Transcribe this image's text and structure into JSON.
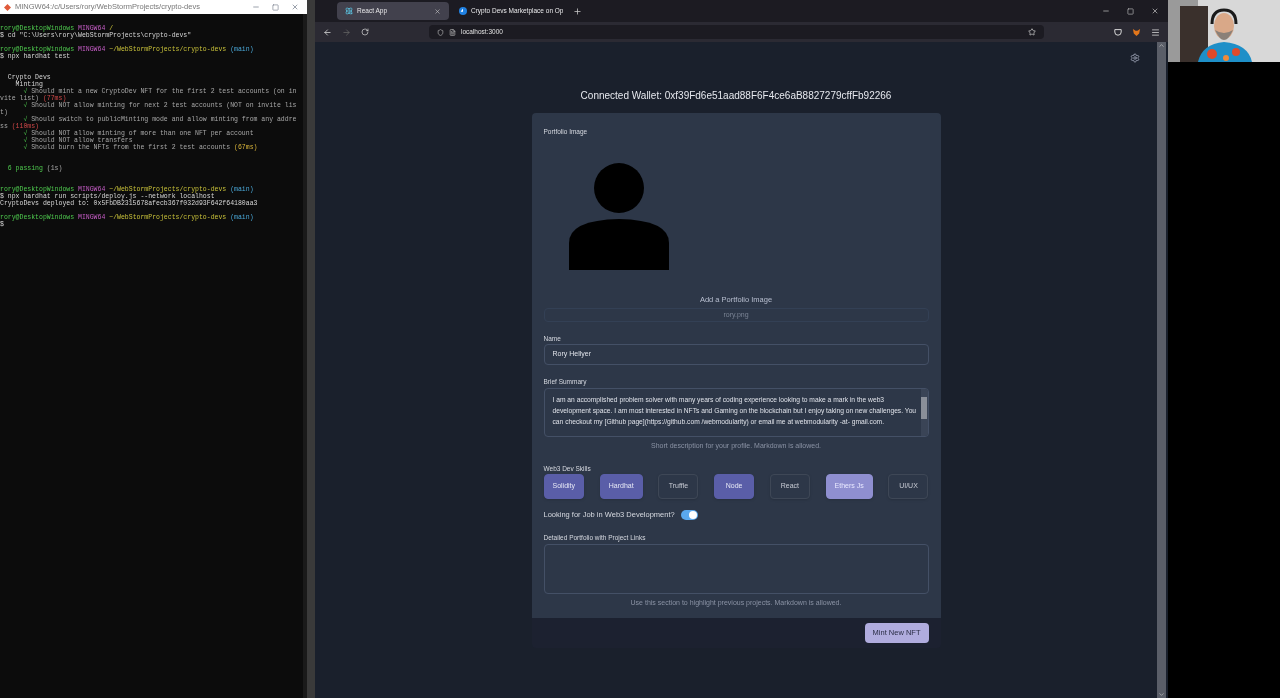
{
  "terminal": {
    "title": "MINGW64:/c/Users/rory/WebStormProjects/crypto-devs",
    "lines": [
      {
        "kind": "text",
        "segments": [
          {
            "text": "rory@DesktopWindows ",
            "kind": "user"
          },
          {
            "text": "MINGW64 ",
            "kind": "shell"
          },
          {
            "text": "/",
            "kind": "path"
          }
        ]
      },
      {
        "kind": "text",
        "segments": [
          {
            "text": "$ cd \"C:\\Users\\rory\\WebStormProjects\\crypto-devs\"",
            "kind": "plain"
          }
        ]
      },
      {
        "kind": "blank"
      },
      {
        "kind": "text",
        "segments": [
          {
            "text": "rory@DesktopWindows ",
            "kind": "user"
          },
          {
            "text": "MINGW64 ",
            "kind": "shell"
          },
          {
            "text": "~/WebStormProjects/crypto-devs ",
            "kind": "path"
          },
          {
            "text": "(main)",
            "kind": "branch"
          }
        ]
      },
      {
        "kind": "text",
        "segments": [
          {
            "text": "$ npx hardhat test",
            "kind": "plain"
          }
        ]
      },
      {
        "kind": "blank"
      },
      {
        "kind": "blank"
      },
      {
        "kind": "text",
        "segments": [
          {
            "text": "  Crypto Devs",
            "kind": "plain"
          }
        ]
      },
      {
        "kind": "text",
        "segments": [
          {
            "text": "    Minting",
            "kind": "plain"
          }
        ]
      },
      {
        "kind": "text",
        "segments": [
          {
            "text": "      √",
            "kind": "pass"
          },
          {
            "text": " Should mint a new CryptoDev NFT for the first 2 test accounts (on in",
            "kind": "dim"
          }
        ]
      },
      {
        "kind": "text",
        "segments": [
          {
            "text": "vite list) ",
            "kind": "dim"
          },
          {
            "text": "(77ms)",
            "kind": "slow"
          }
        ]
      },
      {
        "kind": "text",
        "segments": [
          {
            "text": "      √",
            "kind": "pass"
          },
          {
            "text": " Should NOT allow minting for next 2 test accounts (NOT on invite lis",
            "kind": "dim"
          }
        ]
      },
      {
        "kind": "text",
        "segments": [
          {
            "text": "t)",
            "kind": "dim"
          }
        ]
      },
      {
        "kind": "text",
        "segments": [
          {
            "text": "      √",
            "kind": "pass"
          },
          {
            "text": " Should switch to publicMinting mode and allow minting from any addre",
            "kind": "dim"
          }
        ]
      },
      {
        "kind": "text",
        "segments": [
          {
            "text": "ss ",
            "kind": "dim"
          },
          {
            "text": "(110ms)",
            "kind": "slow"
          }
        ]
      },
      {
        "kind": "text",
        "segments": [
          {
            "text": "      √",
            "kind": "pass"
          },
          {
            "text": " Should NOT allow minting of more than one NFT per account",
            "kind": "dim"
          }
        ]
      },
      {
        "kind": "text",
        "segments": [
          {
            "text": "      √",
            "kind": "pass"
          },
          {
            "text": " Should NOT allow transfers",
            "kind": "dim"
          }
        ]
      },
      {
        "kind": "text",
        "segments": [
          {
            "text": "      √",
            "kind": "pass"
          },
          {
            "text": " Should burn the NFTs from the first 2 test accounts ",
            "kind": "dim"
          },
          {
            "text": "(67ms)",
            "kind": "medium"
          }
        ]
      },
      {
        "kind": "blank"
      },
      {
        "kind": "blank"
      },
      {
        "kind": "text",
        "segments": [
          {
            "text": "  6 passing ",
            "kind": "pass"
          },
          {
            "text": "(1s)",
            "kind": "dim"
          }
        ]
      },
      {
        "kind": "blank"
      },
      {
        "kind": "blank"
      },
      {
        "kind": "text",
        "segments": [
          {
            "text": "rory@DesktopWindows ",
            "kind": "user"
          },
          {
            "text": "MINGW64 ",
            "kind": "shell"
          },
          {
            "text": "~/WebStormProjects/crypto-devs ",
            "kind": "path"
          },
          {
            "text": "(main)",
            "kind": "branch"
          }
        ]
      },
      {
        "kind": "text",
        "segments": [
          {
            "text": "$ npx hardhat run scripts/deploy.js --network localhost",
            "kind": "plain"
          }
        ]
      },
      {
        "kind": "text",
        "segments": [
          {
            "text": "CryptoDevs deployed to: 0x5FbDB2315678afecb367f032d93F642f64180aa3",
            "kind": "plain"
          }
        ]
      },
      {
        "kind": "blank"
      },
      {
        "kind": "text",
        "segments": [
          {
            "text": "rory@DesktopWindows ",
            "kind": "user"
          },
          {
            "text": "MINGW64 ",
            "kind": "shell"
          },
          {
            "text": "~/WebStormProjects/crypto-devs ",
            "kind": "path"
          },
          {
            "text": "(main)",
            "kind": "branch"
          }
        ]
      },
      {
        "kind": "text",
        "segments": [
          {
            "text": "$",
            "kind": "plain"
          }
        ]
      }
    ]
  },
  "browser": {
    "tabs": [
      {
        "label": "React App",
        "selected": true
      },
      {
        "label": "Crypto Devs Marketplace on Op",
        "selected": false
      }
    ],
    "url": "localhost:3000"
  },
  "page": {
    "wallet": "Connected Wallet: 0xf39Fd6e51aad88F6F4ce6aB8827279cffFb92266",
    "image_label": "Portfolio Image",
    "add_image": "Add a Portfolio Image",
    "file_name": "rory.png",
    "name_label": "Name",
    "name_value": "Rory Hellyer",
    "summary_label": "Brief Summary",
    "summary_value": "I am an accomplished problem solver with many years of coding experience looking to make a mark in the web3 development space. I am most interested in NFTs and Gaming on the blockchain but I enjoy taking on new challenges. You can checkout my [Github page](https://github.com /webmodularity) or email me at webmodularity -at- gmail.com.",
    "summary_hint": "Short description for your profile. Markdown is allowed.",
    "skills_label": "Web3 Dev Skills",
    "skills": [
      {
        "label": "Solidity",
        "selected": true,
        "hovered": false
      },
      {
        "label": "Hardhat",
        "selected": true,
        "hovered": false
      },
      {
        "label": "Truffle",
        "selected": false,
        "hovered": false
      },
      {
        "label": "Node",
        "selected": true,
        "hovered": false
      },
      {
        "label": "React",
        "selected": false,
        "hovered": false
      },
      {
        "label": "Ethers Js",
        "selected": false,
        "hovered": true
      },
      {
        "label": "UI/UX",
        "selected": false,
        "hovered": false
      }
    ],
    "job_label": "Looking for Job in Web3 Development?",
    "job_on": true,
    "portfolio_label": "Detailed Portfolio with Project Links",
    "portfolio_hint": "Use this section to highlight previous projects. Markdown is allowed.",
    "mint_button": "Mint New NFT"
  }
}
